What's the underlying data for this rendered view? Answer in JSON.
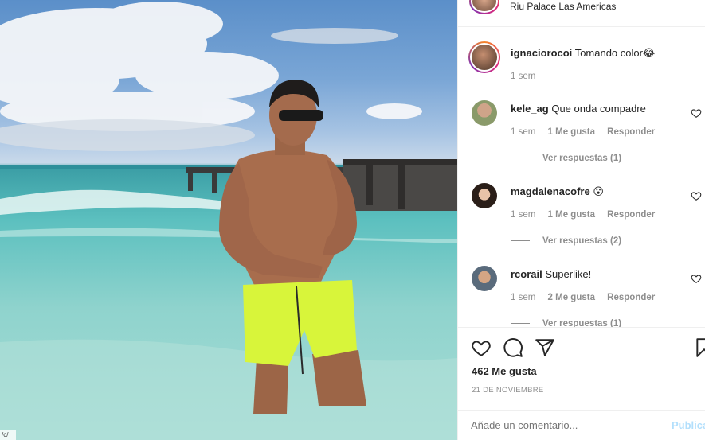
{
  "location": {
    "text": "Riu Palace Las Americas"
  },
  "caption": {
    "username": "ignaciorocoi",
    "text": "Tomando color😂",
    "time": "1 sem"
  },
  "comments": [
    {
      "username": "kele_ag",
      "text": "Que onda compadre",
      "time": "1 sem",
      "likes": "1 Me gusta",
      "reply": "Responder",
      "view_replies": "Ver respuestas (1)"
    },
    {
      "username": "magdalenacofre",
      "text": "😮",
      "time": "1 sem",
      "likes": "1 Me gusta",
      "reply": "Responder",
      "view_replies": "Ver respuestas (2)"
    },
    {
      "username": "rcorail",
      "text": "Superlike!",
      "time": "1 sem",
      "likes": "2 Me gusta",
      "reply": "Responder",
      "view_replies": "Ver respuestas (1)"
    }
  ],
  "actions": {
    "likes": "462 Me gusta",
    "date": "21 DE NOVIEMBRE"
  },
  "add_comment": {
    "placeholder": "Añade un comentario...",
    "publish": "Publicar"
  },
  "photo": {
    "corner_text": "/c/"
  },
  "colors": {
    "text": "#262626",
    "muted": "#8e8e8e",
    "link_disabled": "#b2dffc",
    "divider": "#efefef"
  },
  "icons": [
    "heart-icon",
    "comment-icon",
    "share-icon",
    "bookmark-icon"
  ]
}
